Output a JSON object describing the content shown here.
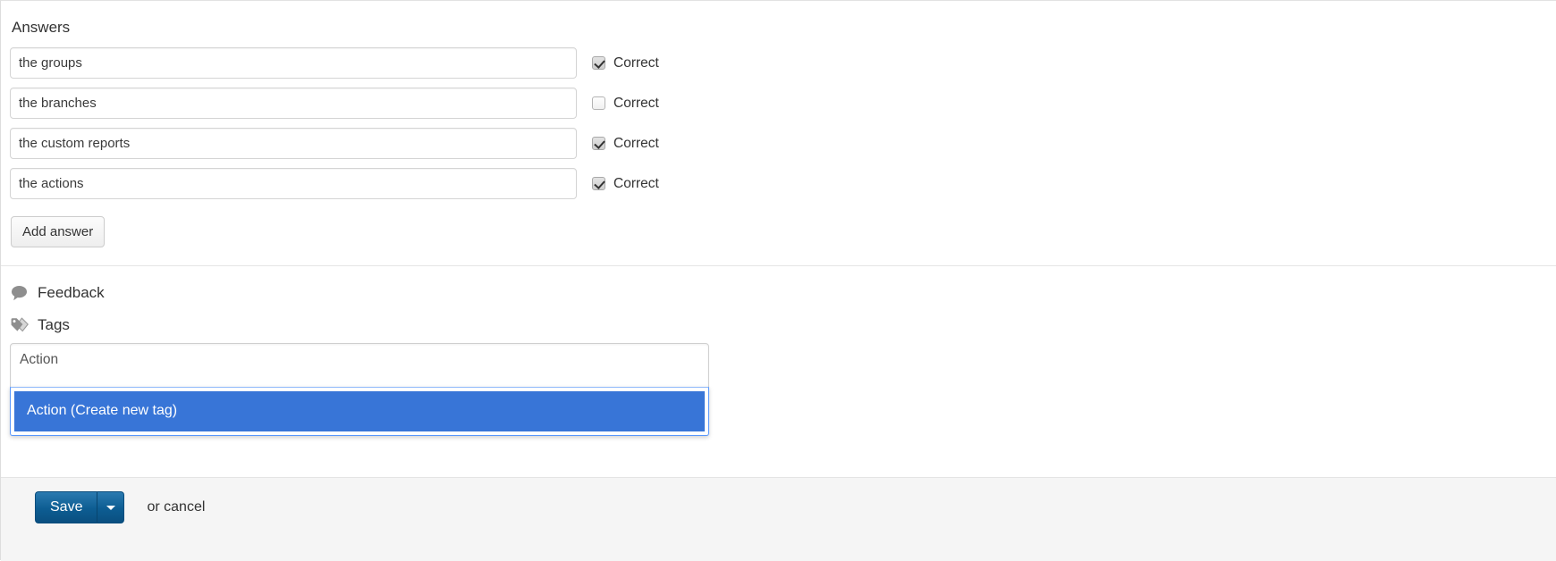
{
  "answers": {
    "heading": "Answers",
    "correct_label": "Correct",
    "add_button_label": "Add answer",
    "items": [
      {
        "text": "the groups",
        "correct": true
      },
      {
        "text": "the branches",
        "correct": false
      },
      {
        "text": "the custom reports",
        "correct": true
      },
      {
        "text": "the actions",
        "correct": true
      }
    ]
  },
  "feedback": {
    "label": "Feedback",
    "icon": "speech-bubble-icon"
  },
  "tags": {
    "label": "Tags",
    "icon": "tag-icon",
    "input_value": "Action",
    "input_placeholder": "",
    "dropdown_options": [
      "Action (Create new tag)"
    ]
  },
  "footer": {
    "save_label": "Save",
    "save_dropdown_icon": "caret-down-icon",
    "cancel_text": "or cancel"
  },
  "colors": {
    "highlight_blue": "#3875d7",
    "dropdown_border_blue": "#5897fb",
    "save_blue": "#0d5d92",
    "footer_bg": "#f5f5f5",
    "icon_grey": "#888888"
  }
}
